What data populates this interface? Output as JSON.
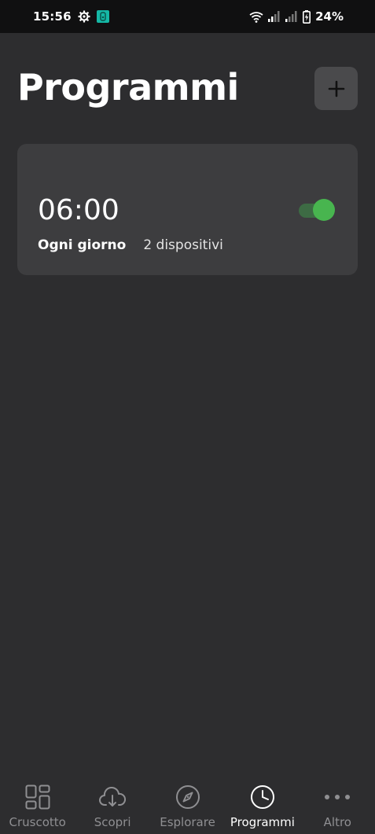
{
  "status_bar": {
    "time": "15:56",
    "battery": "24%",
    "icons": [
      "settings-gear-icon",
      "app-notification-icon",
      "wifi-icon",
      "signal-icon",
      "signal-icon",
      "battery-charging-icon"
    ]
  },
  "header": {
    "title": "Programmi",
    "add_button_icon": "plus-icon"
  },
  "schedules": [
    {
      "time": "06:00",
      "repeat": "Ogni giorno",
      "devices": "2 dispositivi",
      "enabled": true
    }
  ],
  "colors": {
    "background": "#2d2d2f",
    "card": "#3d3d3f",
    "toggle_on": "#48b54f",
    "status_bar": "#101011"
  },
  "bottom_nav": {
    "items": [
      {
        "label": "Cruscotto",
        "icon": "dashboard-icon",
        "active": false
      },
      {
        "label": "Scopri",
        "icon": "cloud-download-icon",
        "active": false
      },
      {
        "label": "Esplorare",
        "icon": "compass-icon",
        "active": false
      },
      {
        "label": "Programmi",
        "icon": "clock-icon",
        "active": true
      },
      {
        "label": "Altro",
        "icon": "more-dots-icon",
        "active": false
      }
    ]
  }
}
